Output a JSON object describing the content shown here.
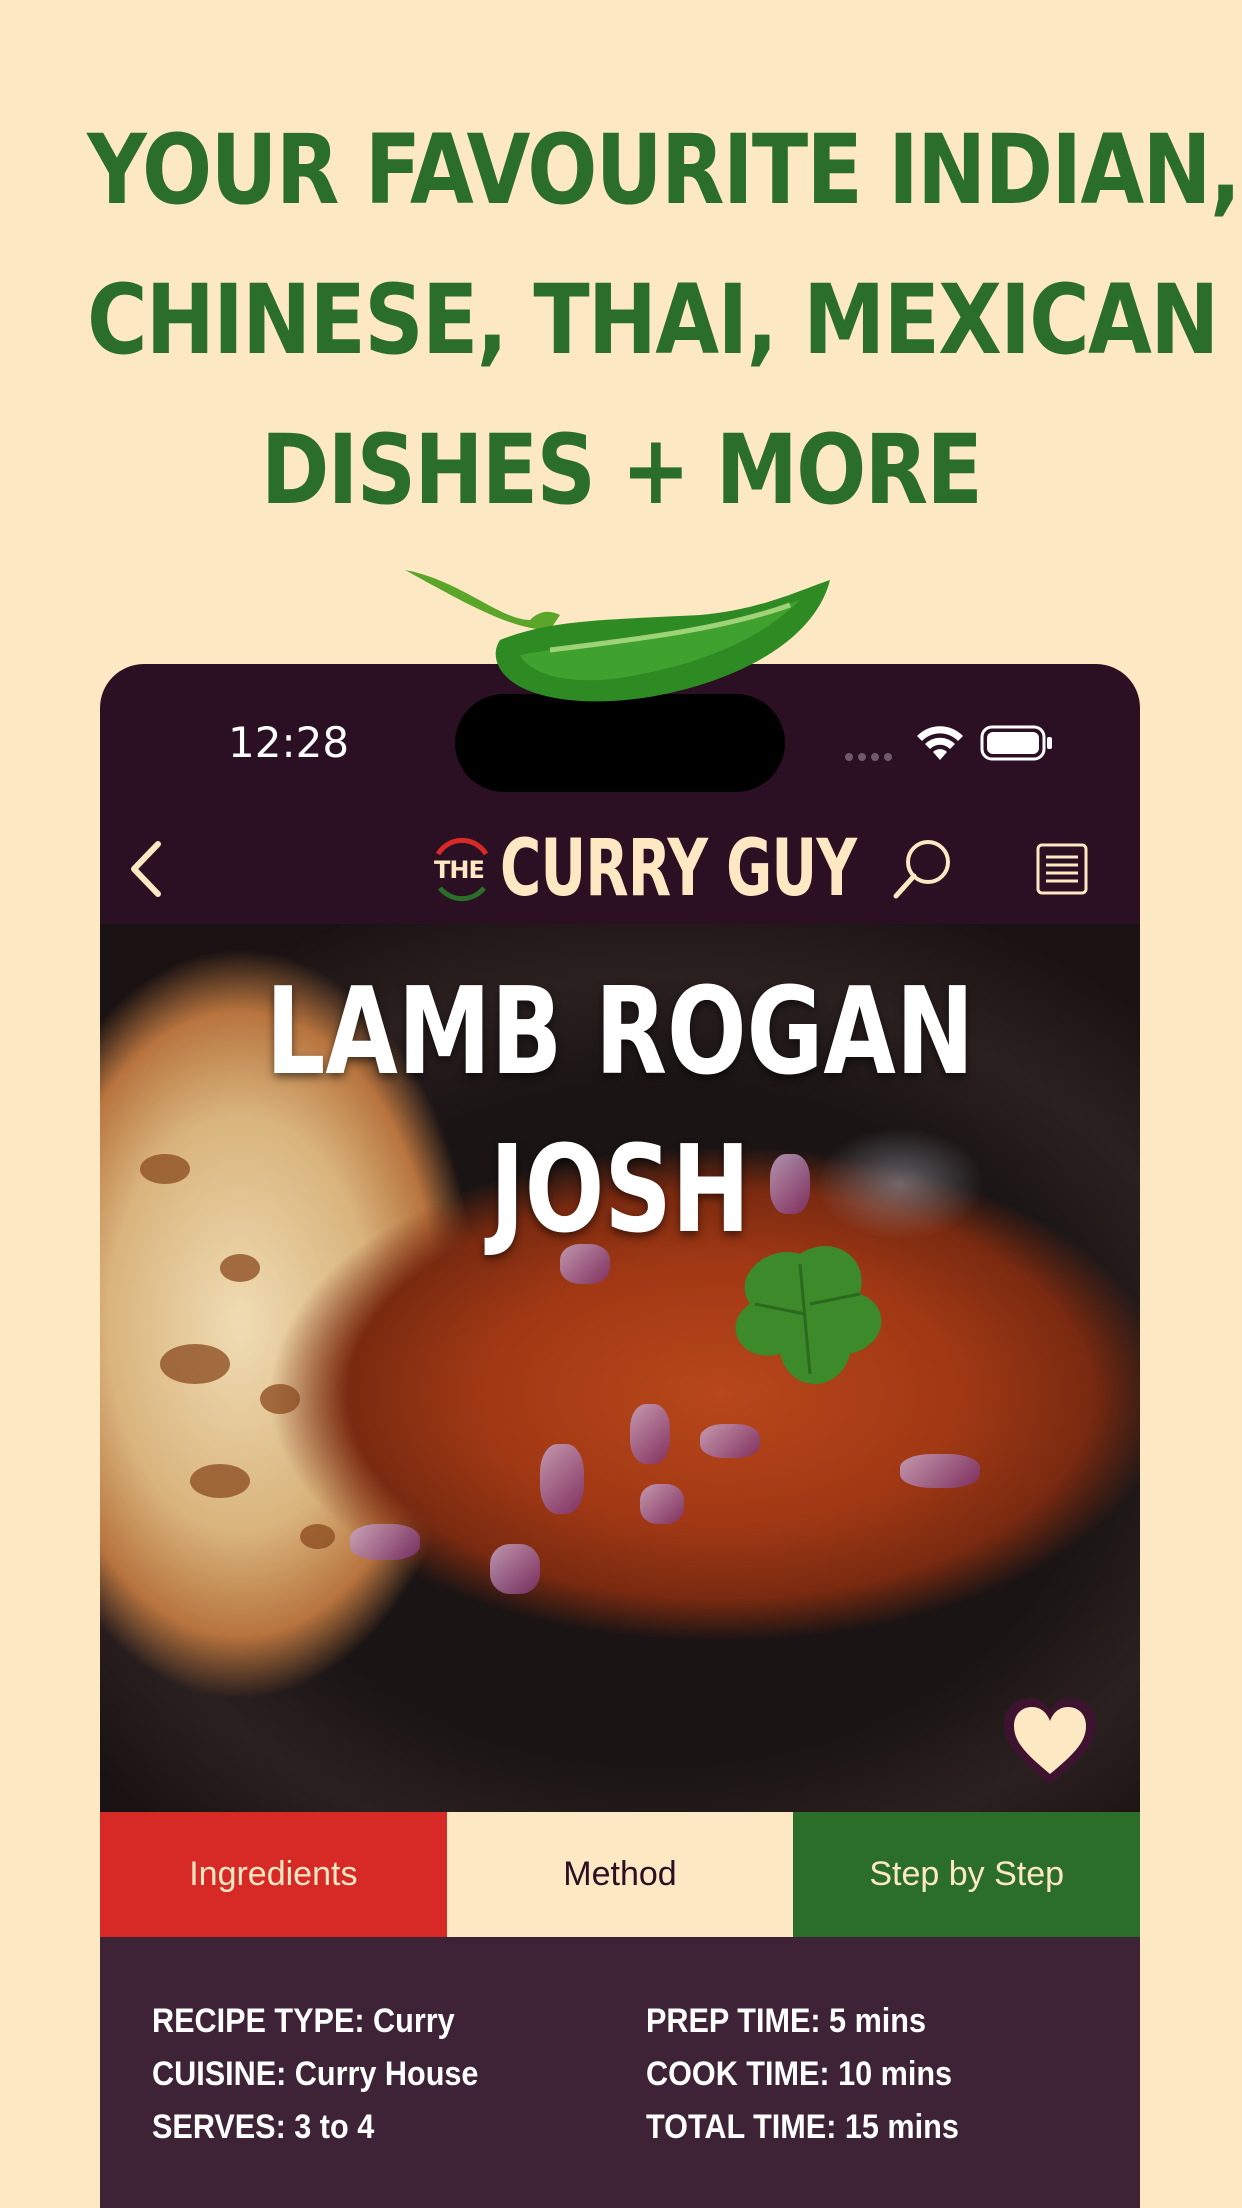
{
  "promo": {
    "headline_lines": [
      "YOUR FAVOURITE INDIAN,",
      "CHINESE, THAI, MEXICAN",
      "DISHES + MORE"
    ]
  },
  "status_bar": {
    "time": "12:28"
  },
  "app": {
    "logo_the": "THE",
    "logo_text": "CURRY GUY"
  },
  "recipe": {
    "title_lines": [
      "LAMB ROGAN",
      "JOSH"
    ]
  },
  "tabs": [
    {
      "label": "Ingredients",
      "color": "#d72a26"
    },
    {
      "label": "Method",
      "color": "#fde8c4"
    },
    {
      "label": "Step by Step",
      "color": "#2a6e2a"
    }
  ],
  "details": {
    "left": [
      "RECIPE TYPE: Curry",
      "CUISINE: Curry House",
      "SERVES: 3 to 4"
    ],
    "right": [
      "PREP TIME: 5 mins",
      "COOK TIME: 10 mins",
      "TOTAL TIME: 15 mins"
    ]
  },
  "colors": {
    "background": "#fde8c4",
    "headline_green": "#2a6e2a",
    "app_dark": "#2b0f22",
    "info_panel": "#3d2335",
    "accent_red": "#d72a26"
  },
  "icons": [
    "back-icon",
    "search-icon",
    "menu-icon",
    "heart-icon",
    "wifi-icon",
    "battery-icon",
    "chili-icon"
  ]
}
